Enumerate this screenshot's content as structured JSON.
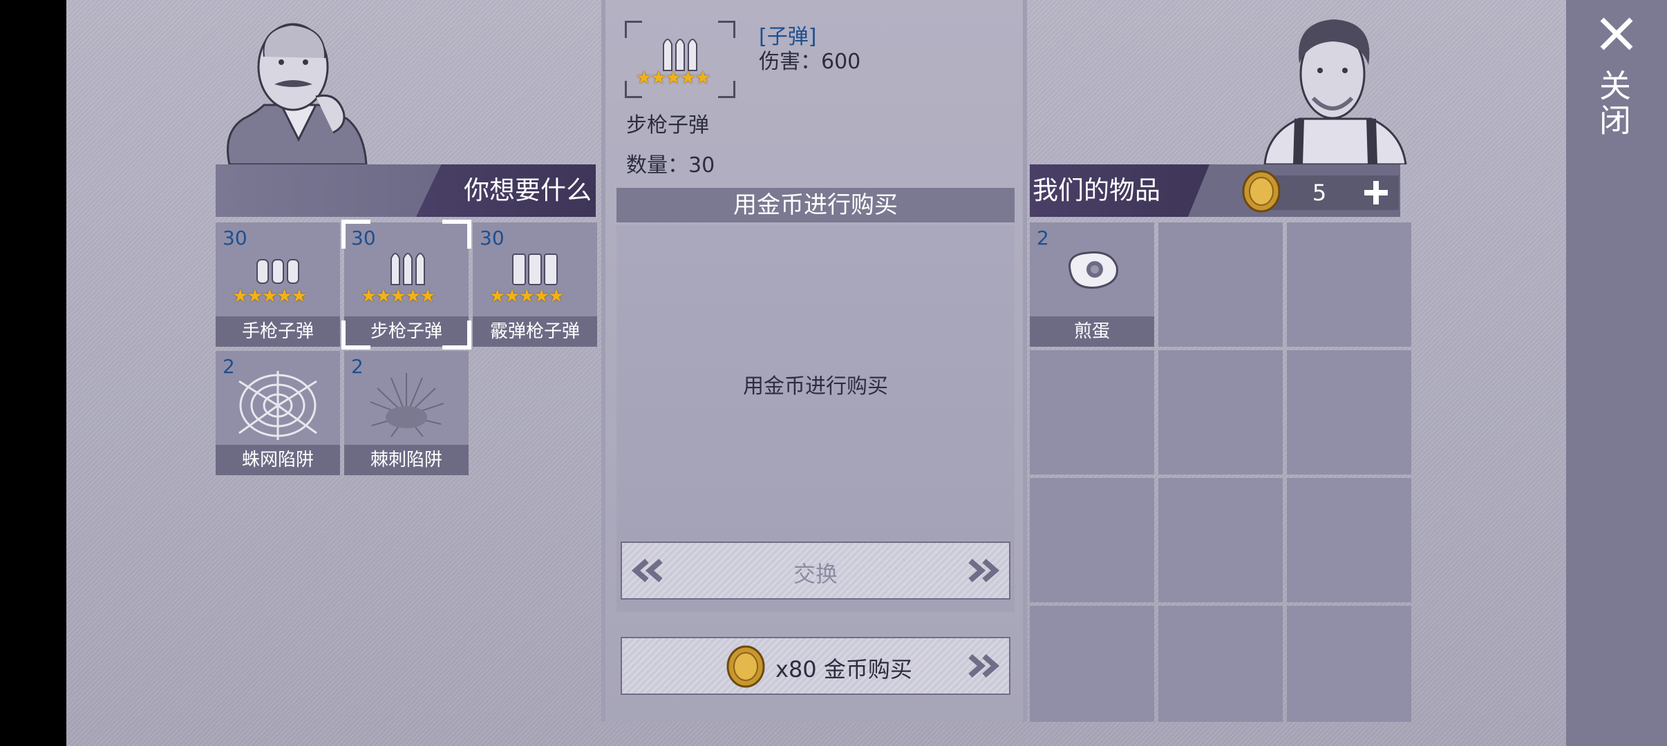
{
  "close": {
    "label": "关闭"
  },
  "left": {
    "header": "你想要什么",
    "items": [
      {
        "qty": "30",
        "label": "手枪子弹",
        "stars": 5
      },
      {
        "qty": "30",
        "label": "步枪子弹",
        "stars": 5,
        "selected": true
      },
      {
        "qty": "30",
        "label": "霰弹枪子弹",
        "stars": 5
      },
      {
        "qty": "2",
        "label": "蛛网陷阱"
      },
      {
        "qty": "2",
        "label": "棘刺陷阱"
      }
    ]
  },
  "detail": {
    "category": "[子弹]",
    "damage": "伤害：600",
    "name": "步枪子弹",
    "quantity": "数量：30",
    "stars": 5,
    "header": "用金币进行购买",
    "body": "用金币进行购买",
    "exchange_label": "交换",
    "buy_label": "x80 金币购买"
  },
  "right": {
    "header": "我们的物品",
    "coins": "5",
    "items": [
      {
        "qty": "2",
        "label": "煎蛋"
      }
    ]
  },
  "colors": {
    "accent": "#4a3f66",
    "qty": "#1f4f8f",
    "coin": "#c9962e"
  }
}
